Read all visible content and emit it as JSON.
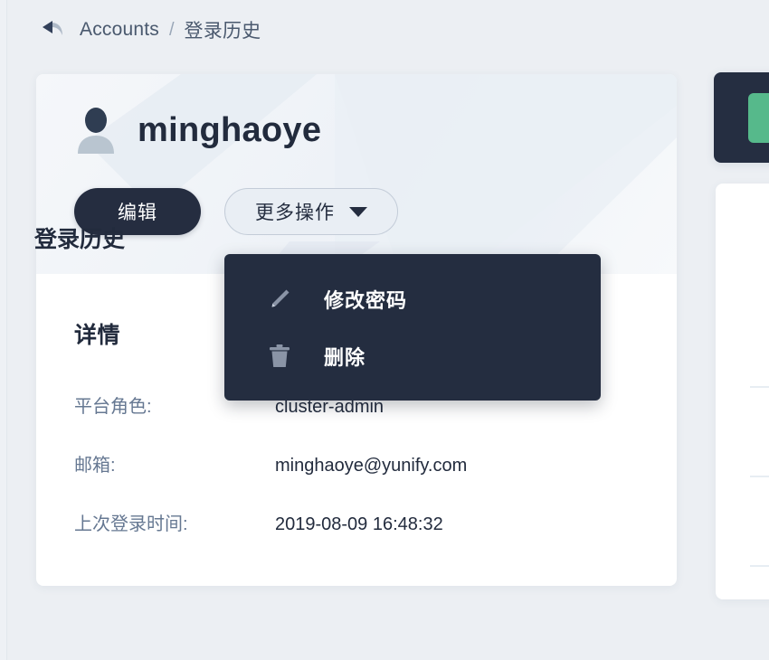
{
  "breadcrumb": {
    "back_icon": "back-arrow-icon",
    "parent": "Accounts",
    "separator": "/",
    "current": "登录历史"
  },
  "user_card": {
    "avatar_icon": "user-avatar-icon",
    "username": "minghaoye",
    "edit_button": "编辑",
    "more_button": "更多操作",
    "more_caret_icon": "chevron-down-icon"
  },
  "dropdown": {
    "visible": true,
    "items": [
      {
        "icon": "pencil-icon",
        "label": "修改密码"
      },
      {
        "icon": "trash-icon",
        "label": "删除"
      }
    ]
  },
  "details": {
    "title": "详情",
    "rows": [
      {
        "label": "平台角色:",
        "value": "cluster-admin"
      },
      {
        "label": "邮箱:",
        "value": "minghaoye@yunify.com"
      },
      {
        "label": "上次登录时间:",
        "value": "2019-08-09 16:48:32"
      }
    ]
  },
  "right_panel": {
    "login_history_title": "登录历史"
  },
  "colors": {
    "page_background": "#eceff3",
    "card_background": "#ffffff",
    "dark_navy": "#252d40",
    "menu_background": "#242d40",
    "accent_green": "#56b98b",
    "muted_text": "#667892",
    "heading_text": "#222b3d",
    "border": "#c3ccd8"
  }
}
